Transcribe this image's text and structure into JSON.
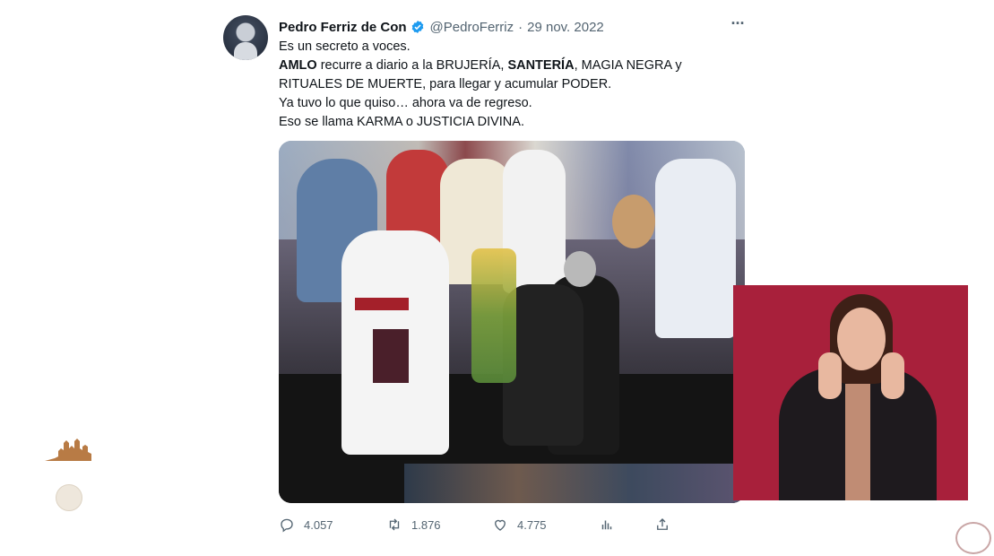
{
  "tweet": {
    "author_name": "Pedro Ferriz de Con",
    "handle": "@PedroFerriz",
    "separator": "·",
    "date": "29 nov. 2022",
    "more_label": "···",
    "lines": {
      "line1": "Es un secreto a voces.",
      "line2_bold_a": "AMLO",
      "line2_a": " recurre a diario a la BRUJERÍA, ",
      "line2_bold_b": "SANTERÍA",
      "line2_b": ", MAGIA NEGRA y",
      "line3": "RITUALES DE MUERTE, para llegar y acumular PODER.",
      "line4": "Ya tuvo lo que quiso… ahora va de regreso.",
      "line5": "Eso se llama KARMA o JUSTICIA DIVINA."
    },
    "stats": {
      "replies": "4.057",
      "retweets": "1.876",
      "likes": "4.775"
    }
  },
  "colors": {
    "text": "#0f1419",
    "secondary": "#536471",
    "verified": "#1d9bf0",
    "interpreter_bg": "#a8203b"
  },
  "icons": [
    "verified-badge-icon",
    "more-icon",
    "reply-icon",
    "retweet-icon",
    "like-icon",
    "analytics-icon",
    "share-icon"
  ]
}
